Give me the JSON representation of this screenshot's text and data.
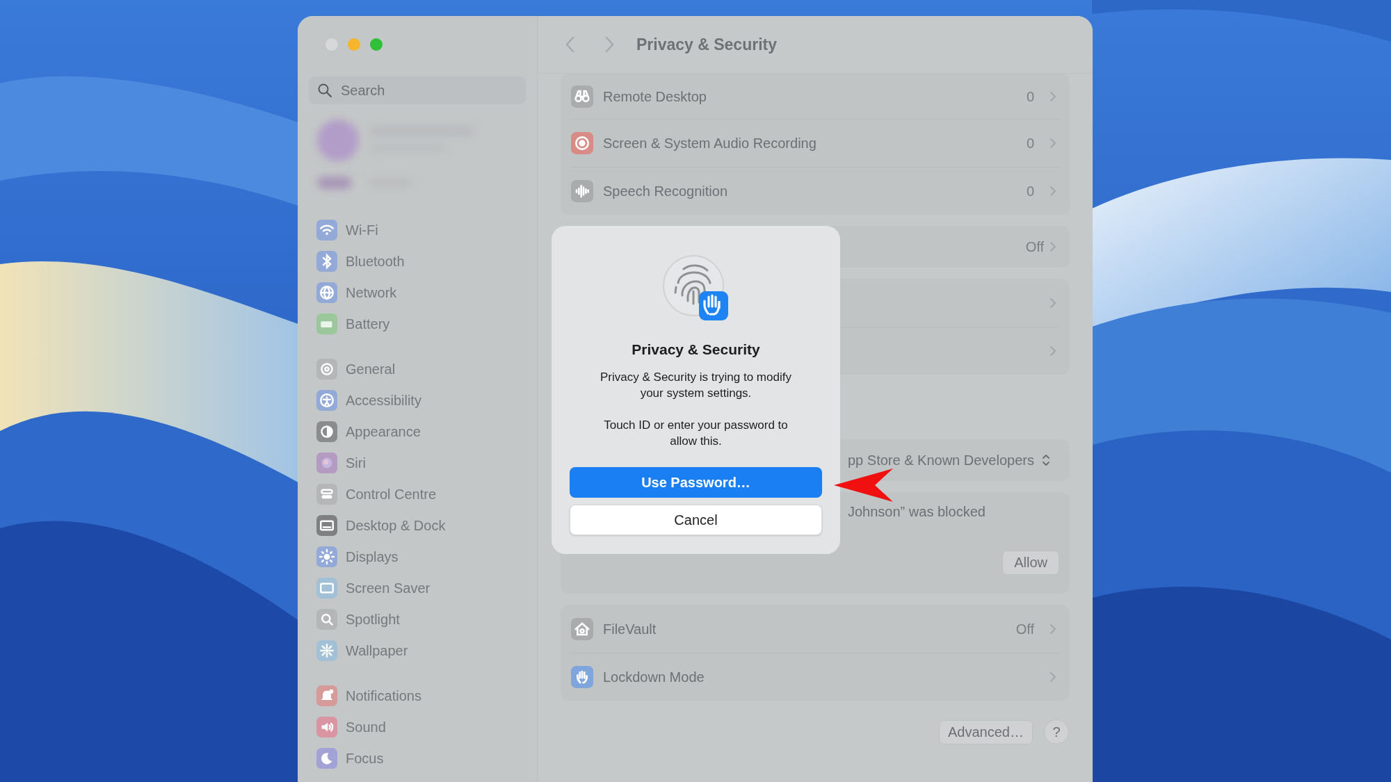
{
  "window": {
    "title": "Privacy & Security"
  },
  "sidebar": {
    "search": {
      "placeholder": "Search"
    },
    "groups": [
      [
        {
          "label": "Wi-Fi",
          "color": "#93a9d8"
        },
        {
          "label": "Bluetooth",
          "color": "#93a9d8"
        },
        {
          "label": "Network",
          "color": "#93a9d8"
        },
        {
          "label": "Battery",
          "color": "#9cc79a"
        }
      ],
      [
        {
          "label": "General",
          "color": "#b4b6b8"
        },
        {
          "label": "Accessibility",
          "color": "#93a9d8"
        },
        {
          "label": "Appearance",
          "color": "#8a8c8e"
        },
        {
          "label": "Siri",
          "color": "#b59ac2"
        },
        {
          "label": "Control Centre",
          "color": "#b4b6b8"
        },
        {
          "label": "Desktop & Dock",
          "color": "#7e8082"
        },
        {
          "label": "Displays",
          "color": "#93a9d8"
        },
        {
          "label": "Screen Saver",
          "color": "#a2c0d6"
        },
        {
          "label": "Spotlight",
          "color": "#b4b6b8"
        },
        {
          "label": "Wallpaper",
          "color": "#a2c0d6"
        }
      ],
      [
        {
          "label": "Notifications",
          "color": "#d69a98"
        },
        {
          "label": "Sound",
          "color": "#d996a2"
        },
        {
          "label": "Focus",
          "color": "#a3a2d6"
        }
      ]
    ]
  },
  "cards": [
    {
      "rows": [
        {
          "kind": "item",
          "label": "Remote Desktop",
          "value": "0",
          "color": "#a9abad"
        },
        {
          "kind": "item",
          "label": "Screen & System Audio Recording",
          "value": "0",
          "color": "#d98c86"
        },
        {
          "kind": "item",
          "label": "Speech Recognition",
          "value": "0",
          "color": "#a9abad"
        }
      ]
    },
    {
      "rows": [
        {
          "kind": "value",
          "value": "Off"
        }
      ]
    },
    {
      "rows": [
        {
          "kind": "value"
        },
        {
          "kind": "value"
        }
      ]
    },
    {
      "rows": [
        {
          "kind": "popup",
          "text": "pp Store & Known Developers"
        }
      ]
    },
    {
      "rows": [
        {
          "kind": "message",
          "text": "Johnson” was blocked"
        },
        {
          "kind": "action",
          "label": "Allow"
        }
      ]
    },
    {
      "rows": [
        {
          "kind": "item",
          "label": "FileVault",
          "value": "Off",
          "color": "#a9abad"
        },
        {
          "kind": "item",
          "label": "Lockdown Mode",
          "color": "#7fa6dc"
        }
      ]
    }
  ],
  "footer": {
    "buttons": [
      "Advanced…",
      "?"
    ]
  },
  "dialog": {
    "title": "Privacy & Security",
    "paragraphs": [
      "Privacy & Security is trying to modify your system settings.",
      "Touch ID or enter your password to allow this."
    ],
    "buttons": [
      {
        "label": "Use Password…",
        "kind": "primary"
      },
      {
        "label": "Cancel",
        "kind": "secondary"
      }
    ]
  }
}
